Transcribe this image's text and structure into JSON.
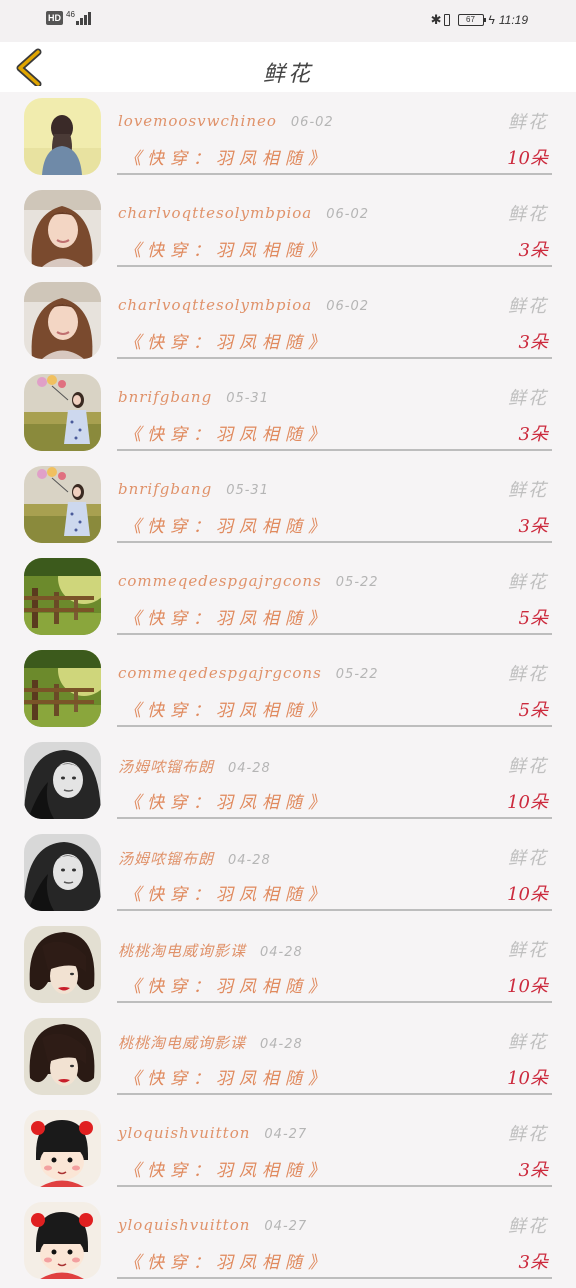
{
  "status_bar": {
    "hd": "HD",
    "network": "46",
    "battery": "67",
    "time": "11:19"
  },
  "header": {
    "title": "鲜花",
    "back_icon": "chevron-left-icon"
  },
  "colors": {
    "name": "#e0926a",
    "count": "#cc2a3d",
    "muted": "#bfbfbf",
    "back": "#e0a500"
  },
  "rows": [
    {
      "name": "lovemoosvwchineo",
      "date": "06-02",
      "type": "鲜花",
      "book": "《快穿：羽凤相随》",
      "count": "10朵",
      "avatar": "girl-back"
    },
    {
      "name": "charlvoqttesolymbpioa",
      "date": "06-02",
      "type": "鲜花",
      "book": "《快穿：羽凤相随》",
      "count": "3朵",
      "avatar": "girl-hair"
    },
    {
      "name": "charlvoqttesolymbpioa",
      "date": "06-02",
      "type": "鲜花",
      "book": "《快穿：羽凤相随》",
      "count": "3朵",
      "avatar": "girl-hair"
    },
    {
      "name": "bnrifgbang",
      "date": "05-31",
      "type": "鲜花",
      "book": "《快穿：羽凤相随》",
      "count": "3朵",
      "avatar": "girl-field"
    },
    {
      "name": "bnrifgbang",
      "date": "05-31",
      "type": "鲜花",
      "book": "《快穿：羽凤相随》",
      "count": "3朵",
      "avatar": "girl-field"
    },
    {
      "name": "commeqedespgajrgcons",
      "date": "05-22",
      "type": "鲜花",
      "book": "《快穿：羽凤相随》",
      "count": "5朵",
      "avatar": "fence"
    },
    {
      "name": "commeqedespgajrgcons",
      "date": "05-22",
      "type": "鲜花",
      "book": "《快穿：羽凤相随》",
      "count": "5朵",
      "avatar": "fence"
    },
    {
      "name": "汤姆哝镏布朗",
      "date": "04-28",
      "type": "鲜花",
      "book": "《快穿：羽凤相随》",
      "count": "10朵",
      "avatar": "bw-girl"
    },
    {
      "name": "汤姆哝镏布朗",
      "date": "04-28",
      "type": "鲜花",
      "book": "《快穿：羽凤相随》",
      "count": "10朵",
      "avatar": "bw-girl"
    },
    {
      "name": "桃桃淘电威询影谍",
      "date": "04-28",
      "type": "鲜花",
      "book": "《快穿：羽凤相随》",
      "count": "10朵",
      "avatar": "dark-hair"
    },
    {
      "name": "桃桃淘电威询影谍",
      "date": "04-28",
      "type": "鲜花",
      "book": "《快穿：羽凤相随》",
      "count": "10朵",
      "avatar": "dark-hair"
    },
    {
      "name": "yloquishvuitton",
      "date": "04-27",
      "type": "鲜花",
      "book": "《快穿：羽凤相随》",
      "count": "3朵",
      "avatar": "cartoon"
    },
    {
      "name": "yloquishvuitton",
      "date": "04-27",
      "type": "鲜花",
      "book": "《快穿：羽凤相随》",
      "count": "3朵",
      "avatar": "cartoon"
    }
  ]
}
